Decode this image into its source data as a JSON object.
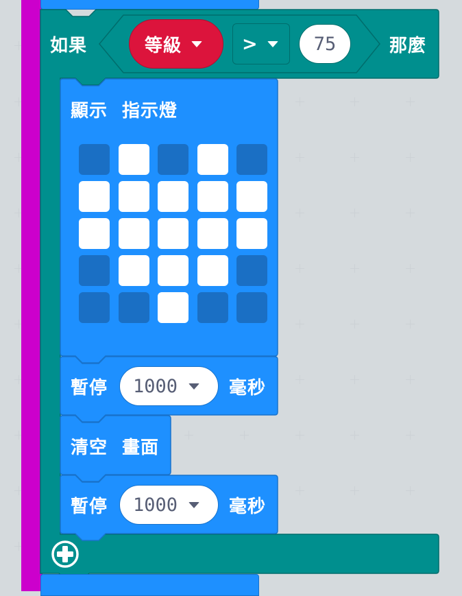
{
  "if_block": {
    "if_label": "如果",
    "then_label": "那麼",
    "variable": "等級",
    "operator": ">",
    "compare_value": "75"
  },
  "show_leds": {
    "label_show": "顯示",
    "label_leds": "指示燈",
    "grid": [
      [
        0,
        1,
        0,
        1,
        0
      ],
      [
        1,
        1,
        1,
        1,
        1
      ],
      [
        1,
        1,
        1,
        1,
        1
      ],
      [
        0,
        1,
        1,
        1,
        0
      ],
      [
        0,
        0,
        1,
        0,
        0
      ]
    ]
  },
  "pause_1": {
    "label": "暫停",
    "value": "1000",
    "unit": "毫秒"
  },
  "clear_screen": {
    "label_clear": "清空",
    "label_screen": "畫面"
  },
  "pause_2": {
    "label": "暫停",
    "value": "1000",
    "unit": "毫秒"
  },
  "colors": {
    "forever_purple": "#cc00cc",
    "logic_teal": "#008f8e",
    "basic_blue": "#1e90ff",
    "variable_red": "#dc143c",
    "workspace_bg": "#ecf0f1"
  },
  "icons": {
    "add_else": "plus-circle-icon",
    "dropdown": "chevron-down-icon"
  }
}
